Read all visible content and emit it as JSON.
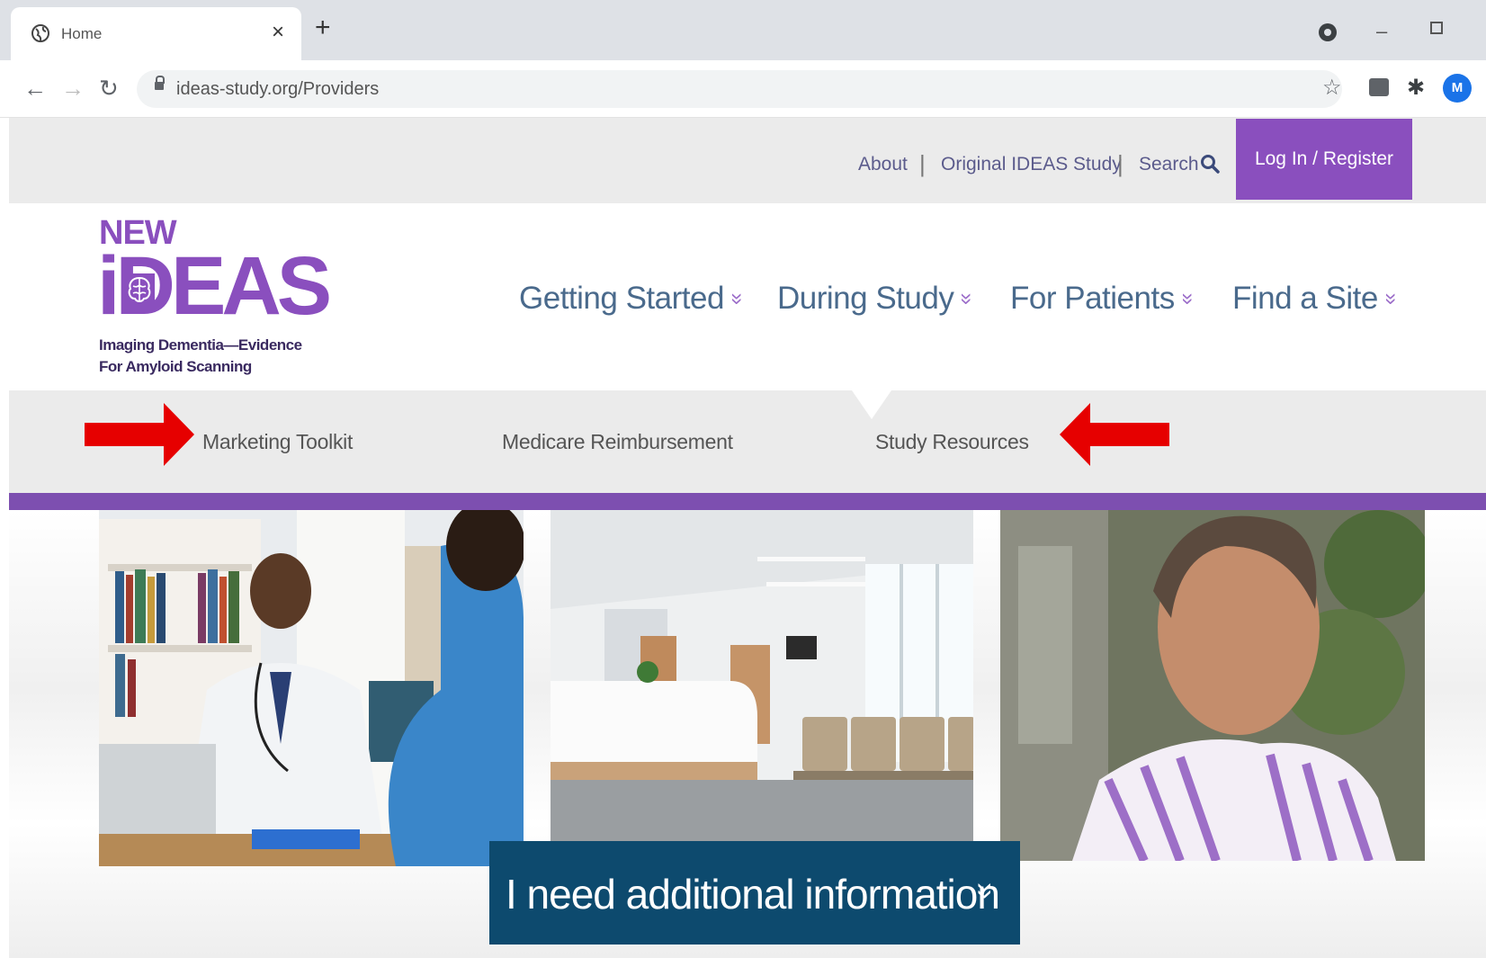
{
  "browser": {
    "tab_title": "Home",
    "tab_close": "×",
    "new_tab": "+",
    "url": "ideas-study.org/Providers",
    "avatar_initial": "M",
    "icons": [
      "globe-icon",
      "back-icon",
      "forward-icon",
      "reload-icon",
      "lock-icon",
      "star-icon",
      "extension-icon",
      "puzzle-icon",
      "record-icon"
    ]
  },
  "utility": {
    "about": "About",
    "original_study": "Original IDEAS Study",
    "search": "Search",
    "separator": "|",
    "login": "Log In / Register"
  },
  "logo": {
    "new": "NEW",
    "ideas": "iDEAS",
    "tagline_1": "Imaging Dementia—Evidence",
    "tagline_2": "For Amyloid Scanning"
  },
  "main_nav": [
    {
      "label": "Getting Started"
    },
    {
      "label": "During Study"
    },
    {
      "label": "For Patients"
    },
    {
      "label": "Find a Site"
    }
  ],
  "nav_chevron": "»",
  "subnav": [
    {
      "label": "Marketing Toolkit"
    },
    {
      "label": "Medicare Reimbursement"
    },
    {
      "label": "Study Resources"
    }
  ],
  "cta": {
    "label": "I need additional information",
    "chevron": "»"
  },
  "colors": {
    "brand_purple": "#8a4fbe",
    "nav_blue": "#4a6a8c",
    "cta_navy": "#0d4a6e",
    "annotation_arrow": "#e60000"
  }
}
